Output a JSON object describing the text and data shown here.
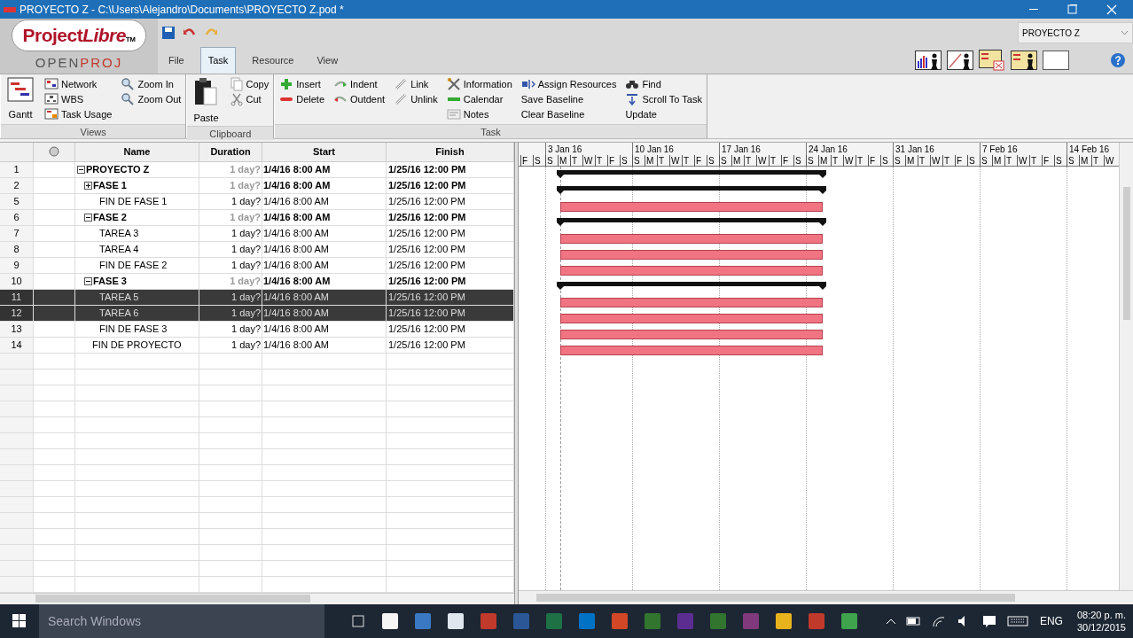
{
  "window": {
    "title": "PROYECTO Z - C:\\Users\\Alejandro\\Documents\\PROYECTO Z.pod *"
  },
  "logo": {
    "word_a": "Project",
    "word_b": "Libre",
    "mark": "TM",
    "sub_a": "OPEN",
    "sub_b": "PROJ"
  },
  "menu_tabs": [
    {
      "label": "File",
      "selected": false
    },
    {
      "label": "Task",
      "selected": true
    },
    {
      "label": "Resource",
      "selected": false
    },
    {
      "label": "View",
      "selected": false
    }
  ],
  "project_selector": {
    "value": "PROYECTO Z"
  },
  "ribbon": [
    {
      "label": "Views",
      "columns": [
        [
          {
            "label": "Gantt",
            "kind": "large"
          }
        ],
        [
          {
            "label": "Network",
            "kind": "small"
          },
          {
            "label": "WBS",
            "kind": "small"
          },
          {
            "label": "Task Usage",
            "kind": "small"
          }
        ],
        [
          {
            "label": "Zoom In",
            "kind": "small"
          },
          {
            "label": "Zoom Out",
            "kind": "small"
          }
        ]
      ]
    },
    {
      "label": "Clipboard",
      "columns": [
        [
          {
            "label": "Paste",
            "kind": "large"
          }
        ],
        [
          {
            "label": "Copy",
            "kind": "small"
          },
          {
            "label": "Cut",
            "kind": "small"
          }
        ]
      ]
    },
    {
      "label": "Task",
      "columns": [
        [
          {
            "label": "Insert",
            "kind": "small"
          },
          {
            "label": "Delete",
            "kind": "small"
          }
        ],
        [
          {
            "label": "Indent",
            "kind": "small"
          },
          {
            "label": "Outdent",
            "kind": "small"
          }
        ],
        [
          {
            "label": "Link",
            "kind": "small"
          },
          {
            "label": "Unlink",
            "kind": "small"
          }
        ],
        [
          {
            "label": "Information",
            "kind": "small"
          },
          {
            "label": "Calendar",
            "kind": "small"
          },
          {
            "label": "Notes",
            "kind": "small"
          }
        ],
        [
          {
            "label": "Assign Resources",
            "kind": "small"
          },
          {
            "label": "Save Baseline",
            "kind": "small"
          },
          {
            "label": "Clear Baseline",
            "kind": "small"
          }
        ],
        [
          {
            "label": "Find",
            "kind": "small"
          },
          {
            "label": "Scroll To Task",
            "kind": "small"
          },
          {
            "label": "Update",
            "kind": "small"
          }
        ]
      ]
    }
  ],
  "table": {
    "columns": [
      "Name",
      "Duration",
      "Start",
      "Finish"
    ],
    "rows": [
      {
        "id": "1",
        "name": "PROYECTO Z",
        "kind": "summary",
        "expanded": true,
        "selected": false,
        "duration": "1 day?",
        "start": "1/4/16 8:00 AM",
        "finish": "1/25/16 12:00 PM",
        "children": [
          {
            "id": "2",
            "name": "FASE 1",
            "kind": "summary",
            "expanded": false,
            "selected": false,
            "duration": "1 day?",
            "start": "1/4/16 8:00 AM",
            "finish": "1/25/16 12:00 PM",
            "children": [
              {
                "id": "5",
                "name": "FIN DE FASE 1",
                "kind": "task",
                "selected": false,
                "duration": "1 day?",
                "start": "1/4/16 8:00 AM",
                "finish": "1/25/16 12:00 PM"
              }
            ]
          },
          {
            "id": "6",
            "name": "FASE 2",
            "kind": "summary",
            "expanded": true,
            "selected": false,
            "duration": "1 day?",
            "start": "1/4/16 8:00 AM",
            "finish": "1/25/16 12:00 PM",
            "children": [
              {
                "id": "7",
                "name": "TAREA 3",
                "kind": "task",
                "selected": false,
                "duration": "1 day?",
                "start": "1/4/16 8:00 AM",
                "finish": "1/25/16 12:00 PM"
              },
              {
                "id": "8",
                "name": "TAREA 4",
                "kind": "task",
                "selected": false,
                "duration": "1 day?",
                "start": "1/4/16 8:00 AM",
                "finish": "1/25/16 12:00 PM"
              },
              {
                "id": "9",
                "name": "FIN DE FASE 2",
                "kind": "task",
                "selected": false,
                "duration": "1 day?",
                "start": "1/4/16 8:00 AM",
                "finish": "1/25/16 12:00 PM"
              }
            ]
          },
          {
            "id": "10",
            "name": "FASE 3",
            "kind": "summary",
            "expanded": true,
            "selected": false,
            "duration": "1 day?",
            "start": "1/4/16 8:00 AM",
            "finish": "1/25/16 12:00 PM",
            "children": [
              {
                "id": "11",
                "name": "TAREA 5",
                "kind": "task",
                "selected": true,
                "duration": "1 day?",
                "start": "1/4/16 8:00 AM",
                "finish": "1/25/16 12:00 PM"
              },
              {
                "id": "12",
                "name": "TAREA 6",
                "kind": "task",
                "selected": true,
                "duration": "1 day?",
                "start": "1/4/16 8:00 AM",
                "finish": "1/25/16 12:00 PM"
              },
              {
                "id": "13",
                "name": "FIN DE FASE 3",
                "kind": "task",
                "selected": false,
                "duration": "1 day?",
                "start": "1/4/16 8:00 AM",
                "finish": "1/25/16 12:00 PM"
              }
            ]
          },
          {
            "id": "14",
            "name": "FIN DE PROYECTO",
            "kind": "task",
            "selected": false,
            "duration": "1 day?",
            "start": "1/4/16 8:00 AM",
            "finish": "1/25/16 12:00 PM"
          }
        ]
      }
    ]
  },
  "gantt": {
    "weeks": [
      "3 Jan 16",
      "10 Jan 16",
      "17 Jan 16",
      "24 Jan 16",
      "31 Jan 16",
      "7 Feb 16",
      "14 Feb 16"
    ],
    "days": [
      "F",
      "S",
      "S",
      "M",
      "T",
      "W",
      "T",
      "F",
      "S",
      "S",
      "M",
      "T",
      "W",
      "T",
      "F",
      "S",
      "S",
      "M",
      "T",
      "W",
      "T",
      "F",
      "S",
      "S",
      "M",
      "T",
      "W",
      "T",
      "F",
      "S",
      "S",
      "M",
      "T",
      "W",
      "T",
      "F",
      "S",
      "S",
      "M",
      "T",
      "W",
      "T",
      "F",
      "S",
      "S",
      "M",
      "T",
      "W"
    ]
  },
  "taskbar": {
    "search_placeholder": "Search Windows",
    "apps": [
      {
        "color": "#f5f5f5"
      },
      {
        "color": "#3b78c4"
      },
      {
        "color": "#dfe6ee"
      },
      {
        "color": "#c0392b"
      },
      {
        "color": "#2b5797"
      },
      {
        "color": "#1e7145"
      },
      {
        "color": "#0072c6"
      },
      {
        "color": "#d24726"
      },
      {
        "color": "#31752f"
      },
      {
        "color": "#5c2d91"
      },
      {
        "color": "#31752f"
      },
      {
        "color": "#80397b"
      },
      {
        "color": "#e8b21c"
      },
      {
        "color": "#c0392b"
      },
      {
        "color": "#3fa34d"
      }
    ],
    "language": "ENG",
    "time": "08:20 p. m.",
    "date": "30/12/2015"
  }
}
